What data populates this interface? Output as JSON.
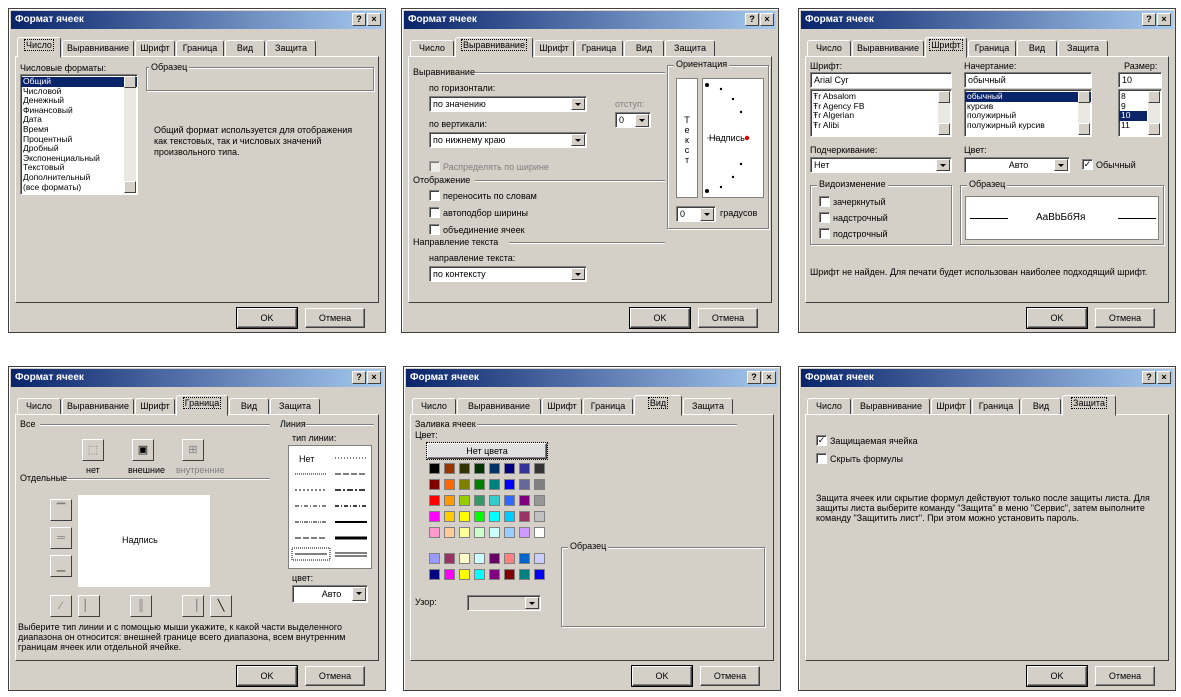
{
  "title": "Формат ячеек",
  "help_label": "?",
  "close_label": "×",
  "tabs": [
    "Число",
    "Выравнивание",
    "Шрифт",
    "Граница",
    "Вид",
    "Защита"
  ],
  "ok_label": "OK",
  "cancel_label": "Отмена",
  "number": {
    "formats_label": "Числовые форматы:",
    "formats": [
      "Общий",
      "Числовой",
      "Денежный",
      "Финансовый",
      "Дата",
      "Время",
      "Процентный",
      "Дробный",
      "Экспоненциальный",
      "Текстовый",
      "Дополнительный",
      "(все форматы)"
    ],
    "sample_label": "Образец",
    "description": "Общий формат используется для отображения как текстовых, так и числовых значений произвольного типа."
  },
  "alignment": {
    "group_alignment": "Выравнивание",
    "horizontal_label": "по горизонтали:",
    "horizontal_value": "по значению",
    "vertical_label": "по вертикали:",
    "vertical_value": "по нижнему краю",
    "indent_label": "отступ:",
    "indent_value": "0",
    "distribute_label": "Распределять по ширине",
    "group_display": "Отображение",
    "wrap_label": "переносить по словам",
    "autofit_label": "автоподбор ширины",
    "merge_label": "объединение ячеек",
    "group_direction": "Направление текста",
    "direction_label": "направление текста:",
    "direction_value": "по контексту",
    "orientation_label": "Ориентация",
    "vertical_text": [
      "Т",
      "е",
      "к",
      "с",
      "т"
    ],
    "orientation_sample": "Надпись",
    "degrees_value": "0",
    "degrees_label": "градусов"
  },
  "font": {
    "font_label": "Шрифт:",
    "font_value": "Arial Cyr",
    "fonts": [
      "Absalom",
      "Agency FB",
      "Algerian",
      "Alibi"
    ],
    "style_label": "Начертание:",
    "style_value": "обычный",
    "styles": [
      "обычный",
      "курсив",
      "полужирный",
      "полужирный курсив"
    ],
    "size_label": "Размер:",
    "size_value": "10",
    "sizes": [
      "8",
      "9",
      "10",
      "11"
    ],
    "underline_label": "Подчеркивание:",
    "underline_value": "Нет",
    "color_label": "Цвет:",
    "color_value": "Авто",
    "normal_label": "Обычный",
    "effects_label": "Видоизменение",
    "strike_label": "зачеркнутый",
    "super_label": "надстрочный",
    "sub_label": "подстрочный",
    "sample_label": "Образец",
    "sample_text": "AaBbБбЯя",
    "note": "Шрифт не найден. Для печати будет использован наиболее подходящий шрифт."
  },
  "border": {
    "all_label": "Все",
    "none_label": "нет",
    "outline_label": "внешние",
    "inside_label": "внутренние",
    "separate_label": "Отдельные",
    "preview_text": "Надпись",
    "line_label": "Линия",
    "line_type_label": "тип линии:",
    "line_none": "Нет",
    "color_label": "цвет:",
    "color_value": "Авто",
    "note": "Выберите тип линии и с помощью мыши укажите, к какой части выделенного диапазона он относится: внешней границе всего диапазона, всем внутренним границам ячеек или отдельной ячейке."
  },
  "pattern": {
    "fill_label": "Заливка ячеек",
    "color_label": "Цвет:",
    "no_color": "Нет цвета",
    "sample_label": "Образец",
    "pattern_label": "Узор:",
    "palette": [
      [
        "#000000",
        "#993300",
        "#333300",
        "#003300",
        "#003366",
        "#000080",
        "#333399",
        "#333333"
      ],
      [
        "#800000",
        "#ff6600",
        "#808000",
        "#008000",
        "#008080",
        "#0000ff",
        "#666699",
        "#808080"
      ],
      [
        "#ff0000",
        "#ff9900",
        "#99cc00",
        "#339966",
        "#33cccc",
        "#3366ff",
        "#800080",
        "#969696"
      ],
      [
        "#ff00ff",
        "#ffcc00",
        "#ffff00",
        "#00ff00",
        "#00ffff",
        "#00ccff",
        "#993366",
        "#c0c0c0"
      ],
      [
        "#ff99cc",
        "#ffcc99",
        "#ffff99",
        "#ccffcc",
        "#ccffff",
        "#99ccff",
        "#cc99ff",
        "#ffffff"
      ]
    ],
    "palette2": [
      [
        "#9999ff",
        "#993366",
        "#ffffcc",
        "#ccffff",
        "#660066",
        "#ff8080",
        "#0066cc",
        "#ccccff"
      ],
      [
        "#000080",
        "#ff00ff",
        "#ffff00",
        "#00ffff",
        "#800080",
        "#800000",
        "#008080",
        "#0000ff"
      ]
    ]
  },
  "protection": {
    "locked_label": "Защищаемая ячейка",
    "hidden_label": "Скрыть формулы",
    "note": "Защита ячеек или скрытие формул действуют только после защиты листа. Для защиты листа выберите команду \"Защита\" в меню \"Сервис\", затем выполните команду \"Защитить лист\". При этом можно установить пароль."
  }
}
